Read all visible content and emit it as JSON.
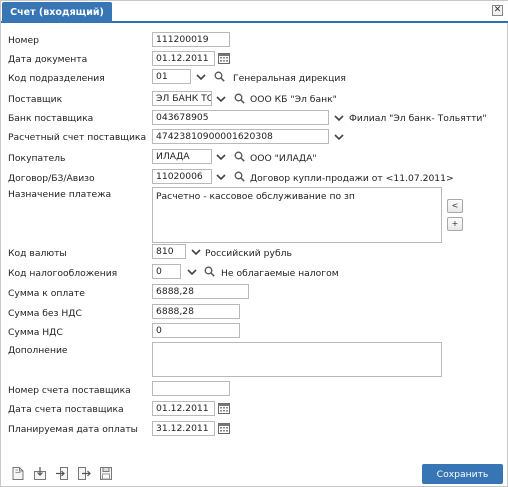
{
  "window": {
    "tab_title": "Счет (входящий)",
    "close_label": "✕"
  },
  "fields": {
    "number": {
      "label": "Номер",
      "value": "111200019"
    },
    "doc_date": {
      "label": "Дата документа",
      "value": "01.12.2011"
    },
    "division_code": {
      "label": "Код подразделения",
      "value": "01",
      "desc": "Генеральная дирекция"
    },
    "supplier": {
      "label": "Поставщик",
      "value": "ЭЛ БАНК ТО",
      "desc": "ООО КБ \"Эл банк\""
    },
    "supplier_bank": {
      "label": "Банк поставщика",
      "value": "043678905",
      "desc": "Филиал \"Эл банк- Тольятти\""
    },
    "supplier_account": {
      "label": "Расчетный счет поставщика",
      "value": "47423810900001620308"
    },
    "buyer": {
      "label": "Покупатель",
      "value": "ИЛАДА",
      "desc": "ООО \"ИЛАДА\""
    },
    "contract": {
      "label": "Договор/БЗ/Авизо",
      "value": "11020006",
      "desc": "Договор купли-продажи от <11.07.2011>"
    },
    "purpose": {
      "label": "Назначение платежа",
      "value": "Расчетно - кассовое обслуживание по зп"
    },
    "currency": {
      "label": "Код валюты",
      "value": "810",
      "desc": "Российский рубль"
    },
    "tax_code": {
      "label": "Код налогообложения",
      "value": "0",
      "desc": "Не облагаемые налогом"
    },
    "amount_due": {
      "label": "Сумма к оплате",
      "value": "6888,28"
    },
    "amount_no_vat": {
      "label": "Сумма без НДС",
      "value": "6888,28"
    },
    "vat": {
      "label": "Сумма НДС",
      "value": "0"
    },
    "addition": {
      "label": "Дополнение",
      "value": ""
    },
    "supplier_invoice_no": {
      "label": "Номер счета поставщика",
      "value": ""
    },
    "supplier_invoice_date": {
      "label": "Дата счета поставщика",
      "value": "01.12.2011"
    },
    "planned_payment_date": {
      "label": "Планируемая дата оплаты",
      "value": "31.12.2011"
    }
  },
  "purpose_buttons": {
    "less": "<",
    "more": "+"
  },
  "footer": {
    "save_label": "Сохранить"
  },
  "colors": {
    "accent": "#3775b4",
    "border": "#b9b9b9"
  }
}
